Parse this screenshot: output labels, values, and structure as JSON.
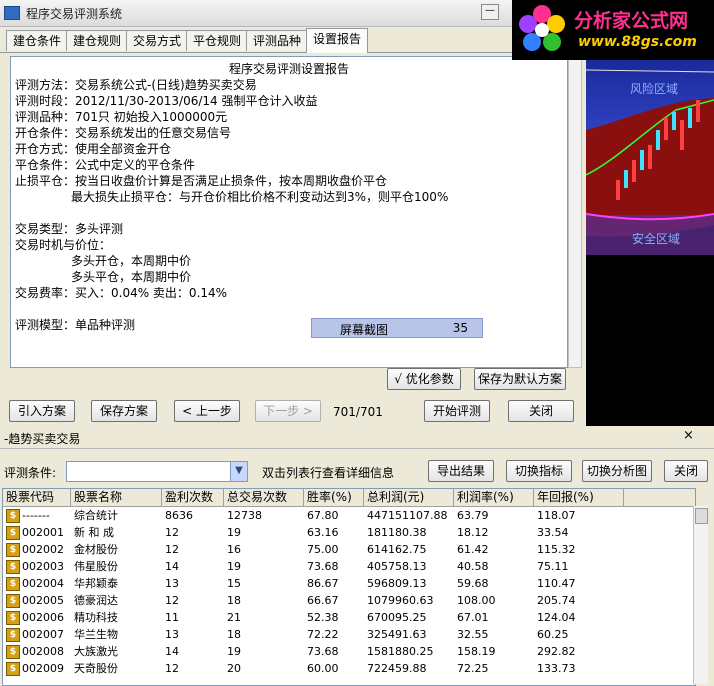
{
  "app": {
    "title": "程序交易评测系统",
    "minimize": "—"
  },
  "tabs": [
    "建仓条件",
    "建仓规则",
    "交易方式",
    "平仓规则",
    "评测品种",
    "设置报告"
  ],
  "report": {
    "title": "程序交易评测设置报告",
    "lines": [
      "评测方法：交易系统公式-(日线)趋势买卖交易",
      "评测时段：2012/11/30-2013/06/14 强制平仓计入收益",
      "评测品种：701只 初始投入1000000元",
      "开仓条件：交易系统发出的任意交易信号",
      "开仓方式：使用全部资金开仓",
      "平仓条件：公式中定义的平仓条件",
      "止损平仓：按当日收盘价计算是否满足止损条件，按本周期收盘价平仓",
      "最大损失止损平仓：与开仓价相比价格不利变动达到3%，则平仓100%",
      "交易类型：多头评测",
      "交易时机与价位：",
      "多头开仓，本周期中价",
      "多头平仓，本周期中价",
      "交易费率：买入：0.04%   卖出：0.14%",
      "评测模型：单品种评测"
    ]
  },
  "capture": {
    "label": "屏幕截图",
    "count": "35"
  },
  "buttons": {
    "optimize": "√ 优化参数",
    "save_default": "保存为默认方案",
    "import": "引入方案",
    "save": "保存方案",
    "prev": "< 上一步",
    "next": "下一步 >",
    "counter": "701/701",
    "start": "开始评测",
    "close": "关闭"
  },
  "chart": {
    "risk_label": "风险区域",
    "safe_label": "安全区域"
  },
  "logo": {
    "text": "分析家公式网",
    "url": "www.88gs.com"
  },
  "results": {
    "title": "-趋势买卖交易",
    "close_x": "×",
    "criteria_label": "评测条件:",
    "criteria_value": "",
    "hint": "双击列表行查看详细信息",
    "export": "导出结果",
    "switch_indicator": "切换指标",
    "switch_chart": "切换分析图",
    "close": "关闭",
    "columns": [
      "股票代码",
      "股票名称",
      "盈利次数",
      "总交易次数",
      "胜率(%)",
      "总利润(元)",
      "利润率(%)",
      "年回报(%)"
    ],
    "rows": [
      [
        "-------",
        "综合统计",
        "8636",
        "12738",
        "67.80",
        "447151107.88",
        "63.79",
        "118.07"
      ],
      [
        "002001",
        "新 和 成",
        "12",
        "19",
        "63.16",
        "181180.38",
        "18.12",
        "33.54"
      ],
      [
        "002002",
        "金材股份",
        "12",
        "16",
        "75.00",
        "614162.75",
        "61.42",
        "115.32"
      ],
      [
        "002003",
        "伟星股份",
        "14",
        "19",
        "73.68",
        "405758.13",
        "40.58",
        "75.11"
      ],
      [
        "002004",
        "华邦颖泰",
        "13",
        "15",
        "86.67",
        "596809.13",
        "59.68",
        "110.47"
      ],
      [
        "002005",
        "德豪润达",
        "12",
        "18",
        "66.67",
        "1079960.63",
        "108.00",
        "205.74"
      ],
      [
        "002006",
        "精功科技",
        "11",
        "21",
        "52.38",
        "670095.25",
        "67.01",
        "124.04"
      ],
      [
        "002007",
        "华兰生物",
        "13",
        "18",
        "72.22",
        "325491.63",
        "32.55",
        "60.25"
      ],
      [
        "002008",
        "大族激光",
        "14",
        "19",
        "73.68",
        "1581880.25",
        "158.19",
        "292.82"
      ],
      [
        "002009",
        "天奇股份",
        "12",
        "20",
        "60.00",
        "722459.88",
        "72.25",
        "133.73"
      ]
    ]
  }
}
